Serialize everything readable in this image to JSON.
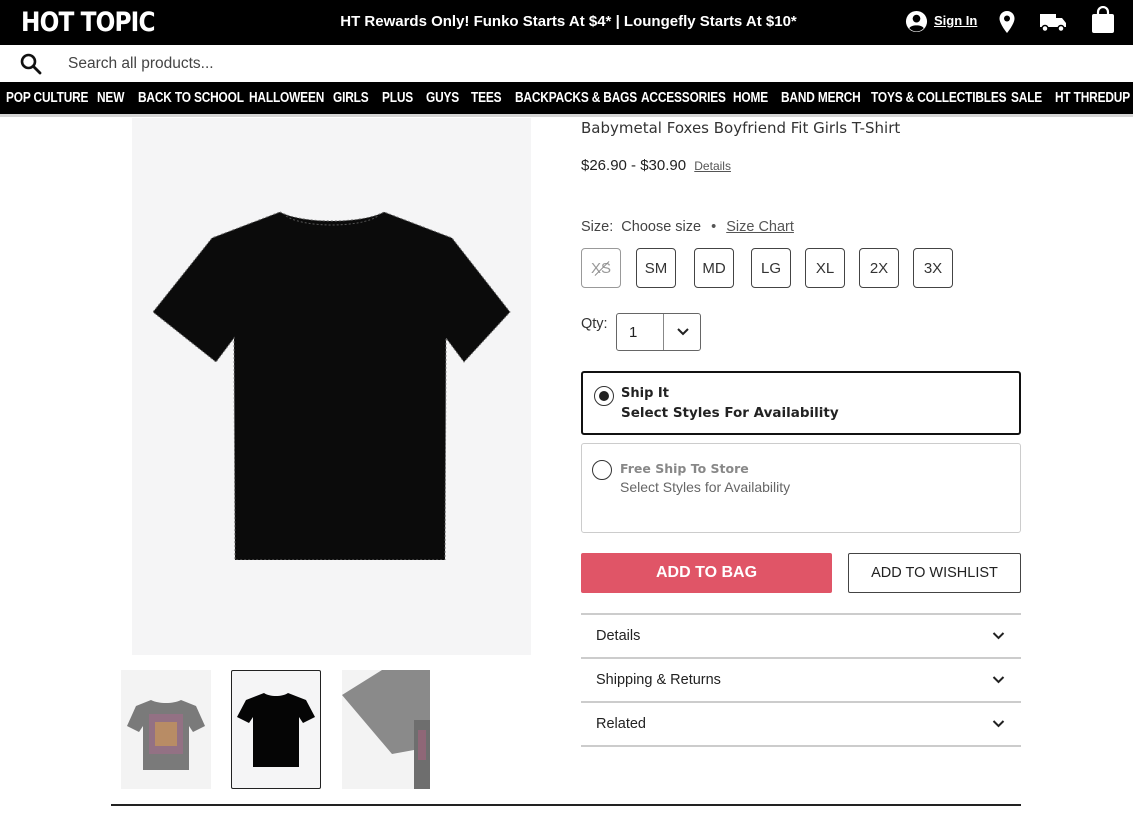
{
  "header": {
    "logo": "HOT TOPIC",
    "promo": "HT Rewards Only! Funko Starts At $4* | Loungefly Starts At $10*",
    "sign_in": "Sign In"
  },
  "search": {
    "placeholder": "Search all products..."
  },
  "nav": {
    "items": [
      "POP CULTURE",
      "NEW",
      "BACK TO SCHOOL",
      "HALLOWEEN",
      "GIRLS",
      "PLUS",
      "GUYS",
      "TEES",
      "BACKPACKS & BAGS",
      "ACCESSORIES",
      "HOME",
      "BAND MERCH",
      "TOYS & COLLECTIBLES",
      "SALE",
      "HT THREDUP"
    ]
  },
  "product": {
    "title": "Babymetal Foxes Boyfriend Fit Girls T-Shirt",
    "price": "$26.90 - $30.90",
    "price_details": "Details",
    "size_label": "Size:",
    "size_value": "Choose size",
    "size_separator": "•",
    "size_chart": "Size Chart",
    "sizes": [
      "XS",
      "SM",
      "MD",
      "LG",
      "XL",
      "2X",
      "3X"
    ],
    "qty_label": "Qty:",
    "qty_value": "1",
    "ship_it_title": "Ship It",
    "ship_it_sub": "Select Styles For Availability",
    "store_title": "Free Ship To Store",
    "store_sub": "Select Styles for Availability",
    "add_to_bag": "ADD TO BAG",
    "add_to_wishlist": "ADD TO WISHLIST",
    "accordions": [
      "Details",
      "Shipping & Returns",
      "Related"
    ]
  },
  "colors": {
    "accent": "#e05567",
    "header_bg": "#000000"
  }
}
